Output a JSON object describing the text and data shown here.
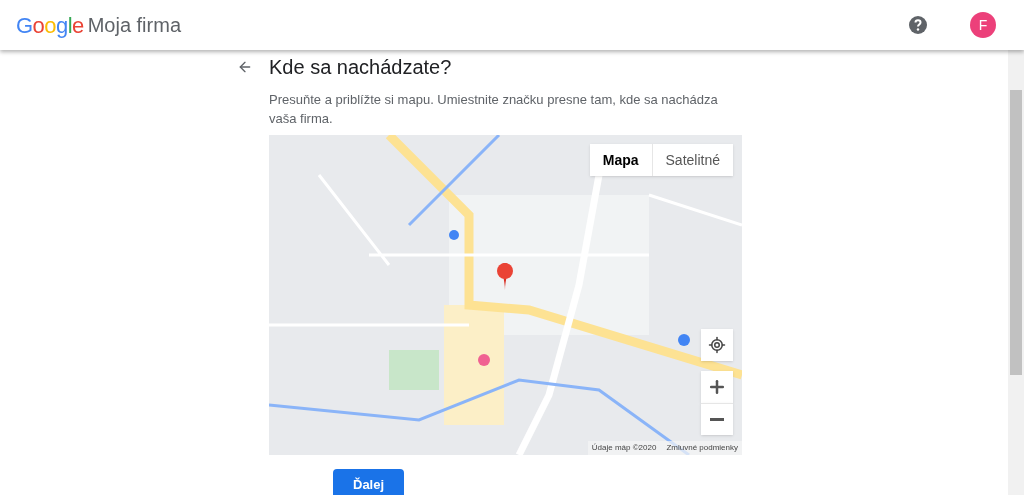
{
  "header": {
    "logo": "Google",
    "product": "Moja firma",
    "avatar": "F"
  },
  "page": {
    "title": "Kde sa nachádzate?",
    "instructions": "Presuňte a priblížte si mapu. Umiestnite značku presne tam, kde sa nachádza vaša firma."
  },
  "map": {
    "map_types": [
      {
        "label": "Mapa",
        "selected": true
      },
      {
        "label": "Satelitné",
        "selected": false
      }
    ],
    "attribution": "Údaje máp ©2020",
    "terms": "Zmluvné podmienky"
  },
  "next_button": "Ďalej"
}
